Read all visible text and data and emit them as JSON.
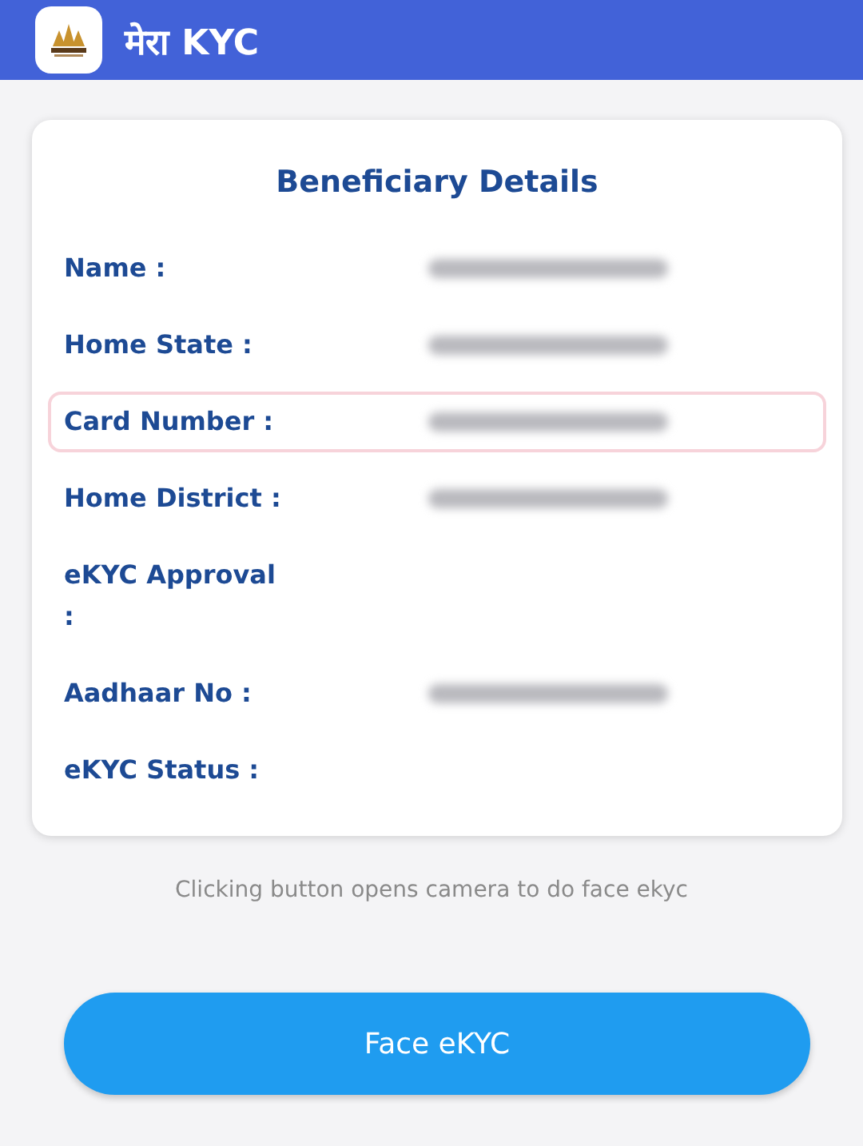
{
  "app_bar": {
    "title": "मेरा KYC"
  },
  "card": {
    "title": "Beneficiary Details",
    "rows": [
      {
        "label": "Name :",
        "redacted": true,
        "highlighted": false
      },
      {
        "label": "Home State :",
        "redacted": true,
        "highlighted": false
      },
      {
        "label": "Card Number :",
        "redacted": true,
        "highlighted": true
      },
      {
        "label": "Home District :",
        "redacted": true,
        "highlighted": false
      },
      {
        "label": "eKYC Approval :",
        "redacted": false,
        "highlighted": false
      },
      {
        "label": "Aadhaar No :",
        "redacted": true,
        "highlighted": false
      },
      {
        "label": "eKYC Status :",
        "redacted": false,
        "highlighted": false
      }
    ]
  },
  "hint": "Clicking button opens camera to do face ekyc",
  "button": {
    "label": "Face eKYC"
  }
}
